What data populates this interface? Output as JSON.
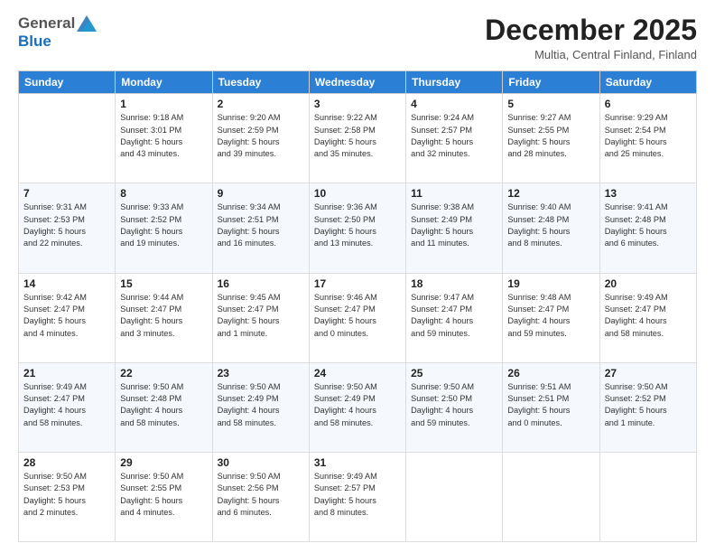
{
  "logo": {
    "general": "General",
    "blue": "Blue"
  },
  "title": "December 2025",
  "subtitle": "Multia, Central Finland, Finland",
  "weekdays": [
    "Sunday",
    "Monday",
    "Tuesday",
    "Wednesday",
    "Thursday",
    "Friday",
    "Saturday"
  ],
  "weeks": [
    [
      {
        "day": "",
        "info": ""
      },
      {
        "day": "1",
        "info": "Sunrise: 9:18 AM\nSunset: 3:01 PM\nDaylight: 5 hours\nand 43 minutes."
      },
      {
        "day": "2",
        "info": "Sunrise: 9:20 AM\nSunset: 2:59 PM\nDaylight: 5 hours\nand 39 minutes."
      },
      {
        "day": "3",
        "info": "Sunrise: 9:22 AM\nSunset: 2:58 PM\nDaylight: 5 hours\nand 35 minutes."
      },
      {
        "day": "4",
        "info": "Sunrise: 9:24 AM\nSunset: 2:57 PM\nDaylight: 5 hours\nand 32 minutes."
      },
      {
        "day": "5",
        "info": "Sunrise: 9:27 AM\nSunset: 2:55 PM\nDaylight: 5 hours\nand 28 minutes."
      },
      {
        "day": "6",
        "info": "Sunrise: 9:29 AM\nSunset: 2:54 PM\nDaylight: 5 hours\nand 25 minutes."
      }
    ],
    [
      {
        "day": "7",
        "info": "Sunrise: 9:31 AM\nSunset: 2:53 PM\nDaylight: 5 hours\nand 22 minutes."
      },
      {
        "day": "8",
        "info": "Sunrise: 9:33 AM\nSunset: 2:52 PM\nDaylight: 5 hours\nand 19 minutes."
      },
      {
        "day": "9",
        "info": "Sunrise: 9:34 AM\nSunset: 2:51 PM\nDaylight: 5 hours\nand 16 minutes."
      },
      {
        "day": "10",
        "info": "Sunrise: 9:36 AM\nSunset: 2:50 PM\nDaylight: 5 hours\nand 13 minutes."
      },
      {
        "day": "11",
        "info": "Sunrise: 9:38 AM\nSunset: 2:49 PM\nDaylight: 5 hours\nand 11 minutes."
      },
      {
        "day": "12",
        "info": "Sunrise: 9:40 AM\nSunset: 2:48 PM\nDaylight: 5 hours\nand 8 minutes."
      },
      {
        "day": "13",
        "info": "Sunrise: 9:41 AM\nSunset: 2:48 PM\nDaylight: 5 hours\nand 6 minutes."
      }
    ],
    [
      {
        "day": "14",
        "info": "Sunrise: 9:42 AM\nSunset: 2:47 PM\nDaylight: 5 hours\nand 4 minutes."
      },
      {
        "day": "15",
        "info": "Sunrise: 9:44 AM\nSunset: 2:47 PM\nDaylight: 5 hours\nand 3 minutes."
      },
      {
        "day": "16",
        "info": "Sunrise: 9:45 AM\nSunset: 2:47 PM\nDaylight: 5 hours\nand 1 minute."
      },
      {
        "day": "17",
        "info": "Sunrise: 9:46 AM\nSunset: 2:47 PM\nDaylight: 5 hours\nand 0 minutes."
      },
      {
        "day": "18",
        "info": "Sunrise: 9:47 AM\nSunset: 2:47 PM\nDaylight: 4 hours\nand 59 minutes."
      },
      {
        "day": "19",
        "info": "Sunrise: 9:48 AM\nSunset: 2:47 PM\nDaylight: 4 hours\nand 59 minutes."
      },
      {
        "day": "20",
        "info": "Sunrise: 9:49 AM\nSunset: 2:47 PM\nDaylight: 4 hours\nand 58 minutes."
      }
    ],
    [
      {
        "day": "21",
        "info": "Sunrise: 9:49 AM\nSunset: 2:47 PM\nDaylight: 4 hours\nand 58 minutes."
      },
      {
        "day": "22",
        "info": "Sunrise: 9:50 AM\nSunset: 2:48 PM\nDaylight: 4 hours\nand 58 minutes."
      },
      {
        "day": "23",
        "info": "Sunrise: 9:50 AM\nSunset: 2:49 PM\nDaylight: 4 hours\nand 58 minutes."
      },
      {
        "day": "24",
        "info": "Sunrise: 9:50 AM\nSunset: 2:49 PM\nDaylight: 4 hours\nand 58 minutes."
      },
      {
        "day": "25",
        "info": "Sunrise: 9:50 AM\nSunset: 2:50 PM\nDaylight: 4 hours\nand 59 minutes."
      },
      {
        "day": "26",
        "info": "Sunrise: 9:51 AM\nSunset: 2:51 PM\nDaylight: 5 hours\nand 0 minutes."
      },
      {
        "day": "27",
        "info": "Sunrise: 9:50 AM\nSunset: 2:52 PM\nDaylight: 5 hours\nand 1 minute."
      }
    ],
    [
      {
        "day": "28",
        "info": "Sunrise: 9:50 AM\nSunset: 2:53 PM\nDaylight: 5 hours\nand 2 minutes."
      },
      {
        "day": "29",
        "info": "Sunrise: 9:50 AM\nSunset: 2:55 PM\nDaylight: 5 hours\nand 4 minutes."
      },
      {
        "day": "30",
        "info": "Sunrise: 9:50 AM\nSunset: 2:56 PM\nDaylight: 5 hours\nand 6 minutes."
      },
      {
        "day": "31",
        "info": "Sunrise: 9:49 AM\nSunset: 2:57 PM\nDaylight: 5 hours\nand 8 minutes."
      },
      {
        "day": "",
        "info": ""
      },
      {
        "day": "",
        "info": ""
      },
      {
        "day": "",
        "info": ""
      }
    ]
  ]
}
